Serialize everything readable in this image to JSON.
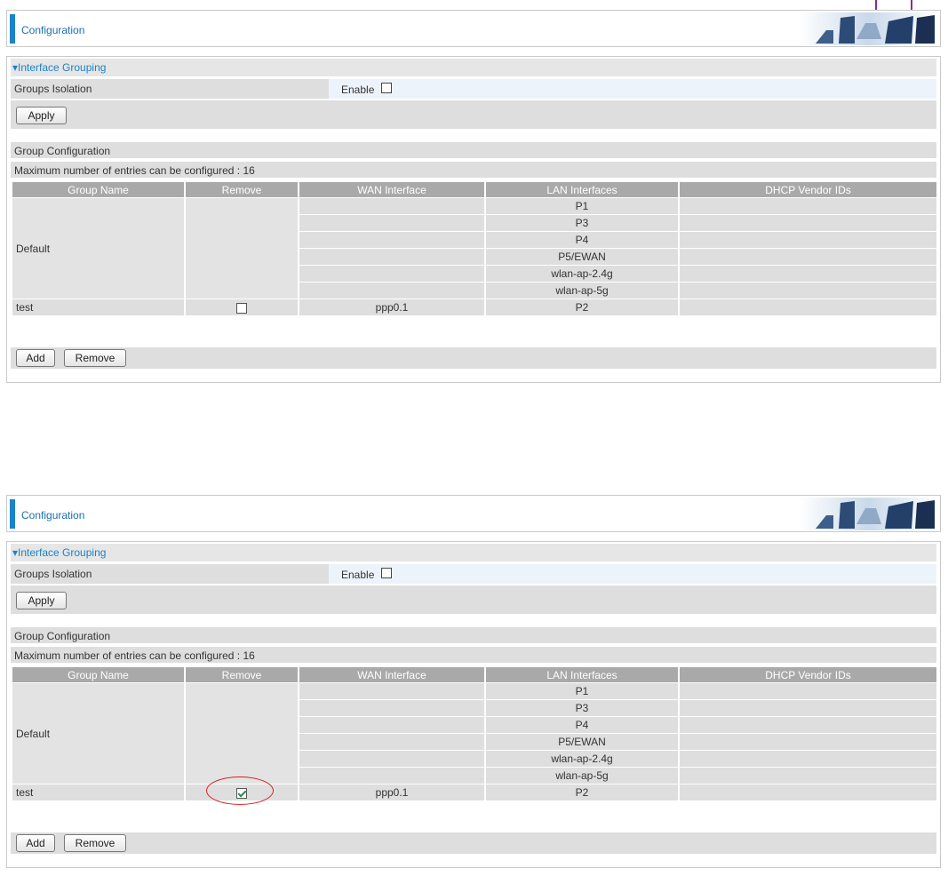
{
  "panels": [
    {
      "header_title": "Configuration",
      "section_title": "▾Interface Grouping",
      "groups_isolation_label": "Groups Isolation",
      "enable_label": "Enable",
      "enable_checked": false,
      "apply_label": "Apply",
      "group_config_title": "Group Configuration",
      "max_entries_text": "Maximum number of entries can be configured : 16",
      "columns": [
        "Group Name",
        "Remove",
        "WAN Interface",
        "LAN Interfaces",
        "DHCP Vendor IDs"
      ],
      "default_group": {
        "name": "Default",
        "lan_interfaces": [
          "P1",
          "P3",
          "P4",
          "P5/EWAN",
          "wlan-ap-2.4g",
          "wlan-ap-5g"
        ]
      },
      "test_group": {
        "name": "test",
        "remove_checked": false,
        "wan_interface": "ppp0.1",
        "lan_interface": "P2",
        "dhcp_vendor_ids": ""
      },
      "add_label": "Add",
      "remove_label": "Remove",
      "highlight_remove": false
    },
    {
      "header_title": "Configuration",
      "section_title": "▾Interface Grouping",
      "groups_isolation_label": "Groups Isolation",
      "enable_label": "Enable",
      "enable_checked": false,
      "apply_label": "Apply",
      "group_config_title": "Group Configuration",
      "max_entries_text": "Maximum number of entries can be configured : 16",
      "columns": [
        "Group Name",
        "Remove",
        "WAN Interface",
        "LAN Interfaces",
        "DHCP Vendor IDs"
      ],
      "default_group": {
        "name": "Default",
        "lan_interfaces": [
          "P1",
          "P3",
          "P4",
          "P5/EWAN",
          "wlan-ap-2.4g",
          "wlan-ap-5g"
        ]
      },
      "test_group": {
        "name": "test",
        "remove_checked": true,
        "wan_interface": "ppp0.1",
        "lan_interface": "P2",
        "dhcp_vendor_ids": ""
      },
      "add_label": "Add",
      "remove_label": "Remove",
      "highlight_remove": true
    }
  ],
  "colors": {
    "accent_blue": "#1a83c9",
    "header_gray": "#a9a9a9",
    "row_gray": "#dedede",
    "annotation_red": "#d52020"
  },
  "icons": {
    "header_art": "network-devices-banner-icon",
    "corner_tab": "page-tab-marker"
  }
}
